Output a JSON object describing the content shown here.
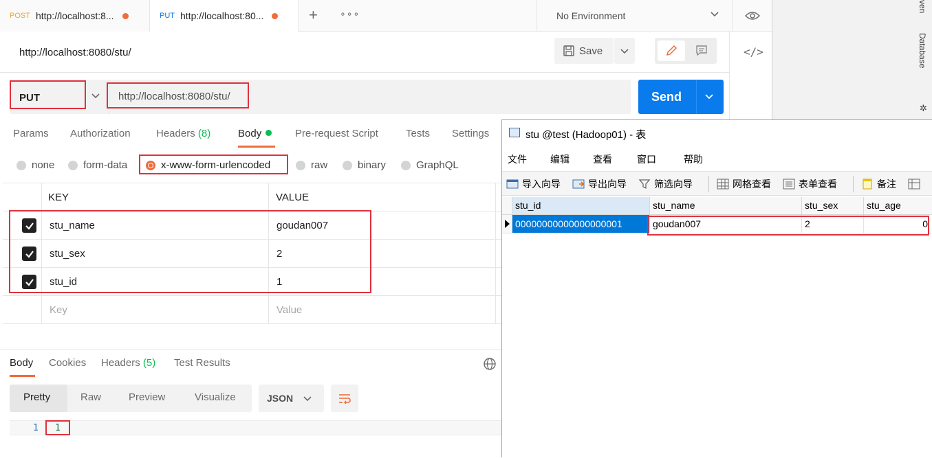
{
  "postman": {
    "tabs": [
      {
        "method": "POST",
        "url": "http://localhost:8...",
        "method_color": "#f5a623"
      },
      {
        "method": "PUT",
        "url": "http://localhost:80...",
        "method_color": "#097bed"
      }
    ],
    "environment": "No Environment",
    "request_name": "http://localhost:8080/stu/",
    "save_label": "Save",
    "method": "PUT",
    "url": "http://localhost:8080/stu/",
    "send_label": "Send",
    "request_tabs": {
      "params": "Params",
      "authorization": "Authorization",
      "headers": "Headers",
      "headers_count": "(8)",
      "body": "Body",
      "prerequest": "Pre-request Script",
      "tests": "Tests",
      "settings": "Settings"
    },
    "body_types": [
      "none",
      "form-data",
      "x-www-form-urlencoded",
      "raw",
      "binary",
      "GraphQL"
    ],
    "selected_body_type": "x-www-form-urlencoded",
    "kv_headers": {
      "key": "KEY",
      "value": "VALUE"
    },
    "kv_rows": [
      {
        "key": "stu_name",
        "value": "goudan007",
        "checked": true
      },
      {
        "key": "stu_sex",
        "value": "2",
        "checked": true
      },
      {
        "key": "stu_id",
        "value": "1",
        "checked": true
      }
    ],
    "kv_placeholder": {
      "key": "Key",
      "value": "Value"
    },
    "response_tabs": {
      "body": "Body",
      "cookies": "Cookies",
      "headers": "Headers",
      "headers_count": "(5)",
      "test_results": "Test Results"
    },
    "view_modes": [
      "Pretty",
      "Raw",
      "Preview",
      "Visualize"
    ],
    "format": "JSON",
    "response_lines": [
      {
        "number": "1",
        "text": "1"
      }
    ],
    "accent_color": "#f26b3a",
    "send_color": "#097bed"
  },
  "ide_edge": {
    "labels": [
      "ven",
      "Database"
    ]
  },
  "navicat": {
    "title": "stu @test (Hadoop01) - 表",
    "menu": [
      "文件",
      "编辑",
      "查看",
      "窗口",
      "帮助"
    ],
    "toolbar": [
      "导入向导",
      "导出向导",
      "筛选向导",
      "网格查看",
      "表单查看",
      "备注"
    ],
    "columns": [
      "stu_id",
      "stu_name",
      "stu_sex",
      "stu_age"
    ],
    "rows": [
      [
        "00000000000000000001",
        "goudan007",
        "2",
        "0"
      ]
    ],
    "selection_color": "#0078d7"
  }
}
